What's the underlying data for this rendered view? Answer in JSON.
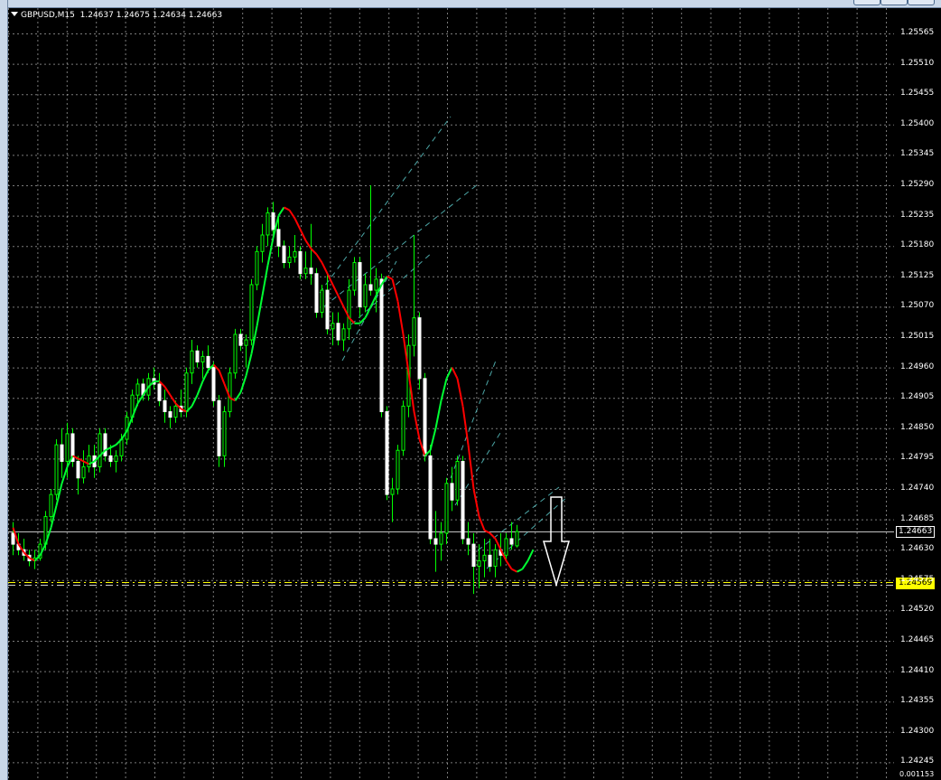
{
  "window": {
    "symbol": "GBPUSD,M15",
    "ohlc": "1.24637 1.24675 1.24634 1.24663",
    "colors": {
      "background": "#000000",
      "grid": "#b0b0b0",
      "bull": "#00ff00",
      "bear": "#ffffff",
      "ma_up": "#00ff33",
      "ma_down": "#ff0000",
      "channel": "#5fd0d0",
      "level": "#ffff00"
    }
  },
  "price_axis": {
    "ticks": [
      "1.25565",
      "1.25510",
      "1.25455",
      "1.25400",
      "1.25345",
      "1.25290",
      "1.25235",
      "1.25180",
      "1.25125",
      "1.25070",
      "1.25015",
      "1.24960",
      "1.24905",
      "1.24850",
      "1.24795",
      "1.24740",
      "1.24685",
      "1.24630",
      "1.24575",
      "1.24520",
      "1.24465",
      "1.24410",
      "1.24355",
      "1.24300",
      "1.24245"
    ],
    "current_price": "1.24663",
    "level_price": "1.24569",
    "bottom_label": "0.001153"
  },
  "arrow": {
    "icon": "arrow-down-icon",
    "direction": "down"
  },
  "chart_data": {
    "type": "candlestick",
    "ylim": [
      1.24235,
      1.25575
    ],
    "current_price": 1.24663,
    "level": 1.24569,
    "candles": [
      [
        1.2466,
        1.2468,
        1.2462,
        1.2464
      ],
      [
        1.2464,
        1.2466,
        1.2462,
        1.2463
      ],
      [
        1.2463,
        1.2465,
        1.2461,
        1.2462
      ],
      [
        1.2462,
        1.2463,
        1.246,
        1.2461
      ],
      [
        1.2461,
        1.2463,
        1.24595,
        1.24615
      ],
      [
        1.24615,
        1.2465,
        1.2461,
        1.2464
      ],
      [
        1.2464,
        1.247,
        1.2463,
        1.2469
      ],
      [
        1.2469,
        1.2474,
        1.2468,
        1.2473
      ],
      [
        1.2473,
        1.2483,
        1.2472,
        1.2482
      ],
      [
        1.2482,
        1.2485,
        1.2476,
        1.2479
      ],
      [
        1.2479,
        1.2486,
        1.2476,
        1.2484
      ],
      [
        1.2484,
        1.2485,
        1.2478,
        1.2479
      ],
      [
        1.2479,
        1.248,
        1.2473,
        1.2476
      ],
      [
        1.2476,
        1.2481,
        1.2475,
        1.2478
      ],
      [
        1.2478,
        1.2482,
        1.2477,
        1.248
      ],
      [
        1.248,
        1.2482,
        1.2476,
        1.2478
      ],
      [
        1.2478,
        1.2485,
        1.2477,
        1.2484
      ],
      [
        1.2484,
        1.2485,
        1.2479,
        1.248
      ],
      [
        1.248,
        1.2482,
        1.2478,
        1.2479
      ],
      [
        1.2479,
        1.2481,
        1.2477,
        1.248
      ],
      [
        1.248,
        1.2484,
        1.2479,
        1.2483
      ],
      [
        1.2483,
        1.2488,
        1.2482,
        1.2487
      ],
      [
        1.2487,
        1.2492,
        1.2486,
        1.2491
      ],
      [
        1.2491,
        1.2494,
        1.2489,
        1.2493
      ],
      [
        1.2493,
        1.2494,
        1.249,
        1.2491
      ],
      [
        1.2491,
        1.2495,
        1.249,
        1.2494
      ],
      [
        1.2494,
        1.2496,
        1.2492,
        1.2493
      ],
      [
        1.2493,
        1.2495,
        1.2489,
        1.249
      ],
      [
        1.249,
        1.2492,
        1.2486,
        1.2488
      ],
      [
        1.2488,
        1.2489,
        1.2485,
        1.2487
      ],
      [
        1.2487,
        1.249,
        1.2486,
        1.2489
      ],
      [
        1.2489,
        1.2492,
        1.2487,
        1.2488
      ],
      [
        1.2488,
        1.2496,
        1.2487,
        1.2495
      ],
      [
        1.2495,
        1.2501,
        1.2493,
        1.2499
      ],
      [
        1.2499,
        1.25,
        1.2496,
        1.2497
      ],
      [
        1.2497,
        1.2499,
        1.2494,
        1.2498
      ],
      [
        1.2498,
        1.25,
        1.2495,
        1.2496
      ],
      [
        1.2496,
        1.2497,
        1.2489,
        1.249
      ],
      [
        1.249,
        1.2491,
        1.2478,
        1.248
      ],
      [
        1.248,
        1.2489,
        1.2478,
        1.2488
      ],
      [
        1.2488,
        1.2496,
        1.2487,
        1.2495
      ],
      [
        1.2495,
        1.2503,
        1.2494,
        1.2502
      ],
      [
        1.2502,
        1.2503,
        1.2499,
        1.25
      ],
      [
        1.25,
        1.2502,
        1.2496,
        1.2501
      ],
      [
        1.2501,
        1.2512,
        1.25,
        1.2511
      ],
      [
        1.2511,
        1.2518,
        1.251,
        1.2517
      ],
      [
        1.2517,
        1.2522,
        1.2515,
        1.252
      ],
      [
        1.252,
        1.2525,
        1.2518,
        1.2524
      ],
      [
        1.2524,
        1.2526,
        1.252,
        1.2521
      ],
      [
        1.2521,
        1.2523,
        1.2516,
        1.2518
      ],
      [
        1.2518,
        1.2519,
        1.2514,
        1.2515
      ],
      [
        1.2515,
        1.2518,
        1.2514,
        1.2516
      ],
      [
        1.2516,
        1.252,
        1.2515,
        1.2517
      ],
      [
        1.2517,
        1.2518,
        1.2512,
        1.2513
      ],
      [
        1.2513,
        1.2517,
        1.2512,
        1.2514
      ],
      [
        1.2514,
        1.2522,
        1.2511,
        1.2513
      ],
      [
        1.2513,
        1.2514,
        1.2505,
        1.2506
      ],
      [
        1.2506,
        1.2511,
        1.2505,
        1.251
      ],
      [
        1.251,
        1.2513,
        1.2502,
        1.2503
      ],
      [
        1.2503,
        1.2506,
        1.25,
        1.2504
      ],
      [
        1.2504,
        1.2506,
        1.25,
        1.2501
      ],
      [
        1.2501,
        1.2504,
        1.2499,
        1.2503
      ],
      [
        1.2503,
        1.2512,
        1.2501,
        1.251
      ],
      [
        1.251,
        1.2516,
        1.2509,
        1.2515
      ],
      [
        1.2515,
        1.2516,
        1.2505,
        1.2507
      ],
      [
        1.2507,
        1.2513,
        1.2506,
        1.2511
      ],
      [
        1.2511,
        1.2529,
        1.2509,
        1.251
      ],
      [
        1.251,
        1.2514,
        1.2506,
        1.2512
      ],
      [
        1.2512,
        1.2513,
        1.2487,
        1.2488
      ],
      [
        1.2488,
        1.2489,
        1.2472,
        1.2473
      ],
      [
        1.2473,
        1.2476,
        1.2468,
        1.2474
      ],
      [
        1.2474,
        1.2482,
        1.2473,
        1.2481
      ],
      [
        1.2481,
        1.249,
        1.248,
        1.2489
      ],
      [
        1.2489,
        1.2502,
        1.2487,
        1.25
      ],
      [
        1.25,
        1.252,
        1.2498,
        1.2505
      ],
      [
        1.2505,
        1.2506,
        1.2492,
        1.2494
      ],
      [
        1.2494,
        1.2495,
        1.2479,
        1.248
      ],
      [
        1.248,
        1.2482,
        1.2464,
        1.2465
      ],
      [
        1.2465,
        1.247,
        1.2459,
        1.2464
      ],
      [
        1.2464,
        1.2468,
        1.2461,
        1.2466
      ],
      [
        1.2466,
        1.2476,
        1.2464,
        1.2475
      ],
      [
        1.2475,
        1.2478,
        1.247,
        1.2472
      ],
      [
        1.2472,
        1.248,
        1.2471,
        1.2479
      ],
      [
        1.2479,
        1.248,
        1.2464,
        1.2465
      ],
      [
        1.2465,
        1.2468,
        1.2462,
        1.2464
      ],
      [
        1.2464,
        1.2466,
        1.2455,
        1.246
      ],
      [
        1.246,
        1.2464,
        1.2456,
        1.2461
      ],
      [
        1.2461,
        1.2465,
        1.2458,
        1.2462
      ],
      [
        1.2462,
        1.2465,
        1.2459,
        1.246
      ],
      [
        1.246,
        1.2464,
        1.2458,
        1.2463
      ],
      [
        1.2463,
        1.2466,
        1.246,
        1.2462
      ],
      [
        1.2462,
        1.2466,
        1.2461,
        1.2465
      ],
      [
        1.2465,
        1.2468,
        1.2463,
        1.2464
      ],
      [
        1.24637,
        1.24675,
        1.24634,
        1.24663
      ]
    ],
    "ma": [
      1.2467,
      1.2464,
      1.24625,
      1.24615,
      1.2461,
      1.2462,
      1.2464,
      1.2467,
      1.2471,
      1.2475,
      1.2478,
      1.248,
      1.24795,
      1.2479,
      1.24785,
      1.2479,
      1.248,
      1.2481,
      1.24815,
      1.2482,
      1.2483,
      1.24845,
      1.2487,
      1.24895,
      1.2491,
      1.24925,
      1.24935,
      1.24935,
      1.24925,
      1.2491,
      1.24895,
      1.24885,
      1.2488,
      1.2489,
      1.2491,
      1.24935,
      1.24955,
      1.24965,
      1.24955,
      1.2493,
      1.24905,
      1.249,
      1.24915,
      1.24945,
      1.24985,
      1.25035,
      1.2509,
      1.25145,
      1.25195,
      1.25235,
      1.2525,
      1.25245,
      1.2523,
      1.2521,
      1.2519,
      1.25175,
      1.25165,
      1.2515,
      1.2513,
      1.2511,
      1.2509,
      1.2507,
      1.2505,
      1.2504,
      1.2504,
      1.2505,
      1.2507,
      1.2509,
      1.2511,
      1.25125,
      1.2512,
      1.2508,
      1.2502,
      1.2495,
      1.2488,
      1.2483,
      1.248,
      1.2481,
      1.2485,
      1.249,
      1.2494,
      1.2496,
      1.2494,
      1.2489,
      1.2482,
      1.2474,
      1.2469,
      1.24665,
      1.2466,
      1.2465,
      1.2463,
      1.2461,
      1.24595,
      1.2459,
      1.24595,
      1.2461,
      1.2463
    ]
  }
}
